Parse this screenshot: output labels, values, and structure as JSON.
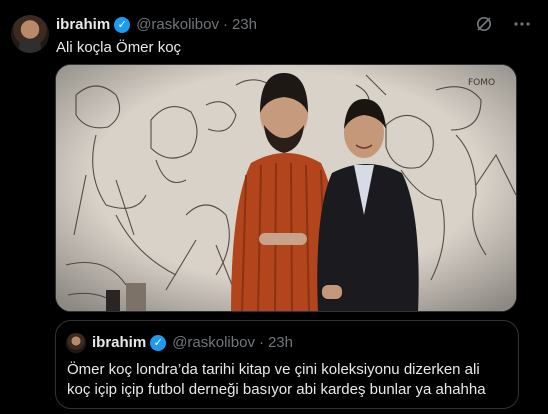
{
  "tweet": {
    "author_name": "ibrahim",
    "handle": "@raskolibov",
    "separator": "·",
    "time": "23h",
    "text": "Ali koçla Ömer koç"
  },
  "icons": {
    "avatar": "avatar",
    "verified": "verified-badge-icon",
    "grok": "grok-icon",
    "more": "more-icon"
  },
  "media": {
    "description": "photo"
  },
  "quote": {
    "author_name": "ibrahim",
    "handle": "@raskolibov",
    "separator": "·",
    "time": "23h",
    "text": "Ömer koç londra’da tarihi kitap ve çini koleksiyonu dizerken ali koç içip içip futbol derneği basıyor abi kardeş bunlar ya ahahha"
  },
  "colors": {
    "background": "#000000",
    "text": "#e7e9ea",
    "secondary": "#71767b",
    "verified": "#1d9bf0",
    "border": "#2f3336"
  }
}
